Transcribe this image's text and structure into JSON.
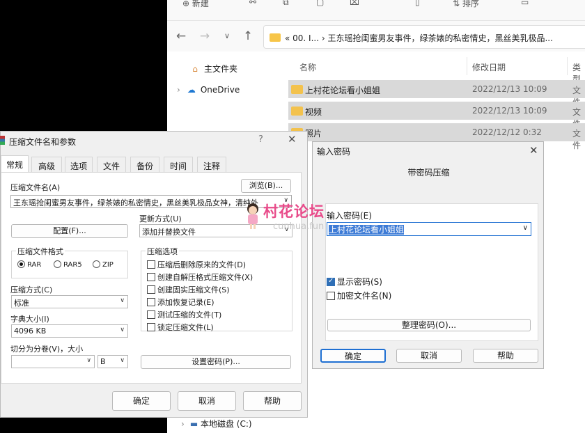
{
  "explorer": {
    "toolbar": {
      "new_label": "新建",
      "sort_label": "排序"
    },
    "address_path": "« 00. I... › 王东瑶抢闺蜜男友事件，绿茶婊的私密情史，黑丝美乳极品...",
    "nav": [
      {
        "label": "主文件夹",
        "icon": "home-icon"
      },
      {
        "label": "OneDrive",
        "icon": "cloud-icon"
      },
      {
        "label": "本地磁盘 (C:)",
        "icon": "drive-icon"
      }
    ],
    "columns": [
      "名称",
      "修改日期",
      "类型"
    ],
    "files": [
      {
        "name": "上村花论坛看小姐姐",
        "date": "2022/12/13 10:09",
        "type": "文件"
      },
      {
        "name": "视频",
        "date": "2022/12/13 10:09",
        "type": "文件"
      },
      {
        "name": "照片",
        "date": "2022/12/12 0:32",
        "type": "文件"
      }
    ]
  },
  "archive_dialog": {
    "title": "压缩文件名和参数",
    "help_glyph": "?",
    "tabs": [
      "常规",
      "高级",
      "选项",
      "文件",
      "备份",
      "时间",
      "注释"
    ],
    "archive_name_label": "压缩文件名(A)",
    "archive_name_value": "王东瑶抢闺蜜男友事件，绿茶婊的私密情史，黑丝美乳极品女神，清纯外",
    "browse_label": "浏览(B)...",
    "profiles_label": "配置(F)...",
    "update_mode_label": "更新方式(U)",
    "update_mode_value": "添加并替换文件",
    "format_group": "压缩文件格式",
    "formats": [
      {
        "label": "RAR",
        "checked": true
      },
      {
        "label": "RAR5",
        "checked": false
      },
      {
        "label": "ZIP",
        "checked": false
      }
    ],
    "method_label": "压缩方式(C)",
    "method_value": "标准",
    "dict_label": "字典大小(I)",
    "dict_value": "4096 KB",
    "split_label": "切分为分卷(V)，大小",
    "split_value": "",
    "split_unit": "B",
    "options_group": "压缩选项",
    "options": [
      {
        "label": "压缩后删除原来的文件(D)",
        "checked": false
      },
      {
        "label": "创建自解压格式压缩文件(X)",
        "checked": false
      },
      {
        "label": "创建固实压缩文件(S)",
        "checked": false
      },
      {
        "label": "添加恢复记录(E)",
        "checked": false
      },
      {
        "label": "测试压缩的文件(T)",
        "checked": false
      },
      {
        "label": "锁定压缩文件(L)",
        "checked": false
      }
    ],
    "set_password_label": "设置密码(P)...",
    "ok_label": "确定",
    "cancel_label": "取消",
    "help_label": "帮助"
  },
  "password_dialog": {
    "title": "输入密码",
    "heading": "带密码压缩",
    "enter_label": "输入密码(E)",
    "password_value": "上村花论坛看小姐姐",
    "show_password": {
      "label": "显示密码(S)",
      "checked": true
    },
    "encrypt_names": {
      "label": "加密文件名(N)",
      "checked": false
    },
    "organize_label": "整理密码(O)...",
    "ok_label": "确定",
    "cancel_label": "取消",
    "help_label": "帮助"
  },
  "watermark": {
    "main": "村花论坛",
    "sub": "cunhua.fun"
  }
}
